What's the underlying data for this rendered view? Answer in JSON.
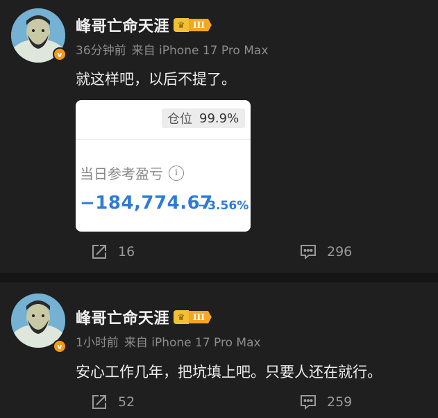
{
  "posts": [
    {
      "author": "峰哥亡命天涯",
      "rank_level": "III",
      "time": "36分钟前",
      "source": "来自 iPhone 17 Pro Max",
      "text": "就这样吧，以后不提了。",
      "card": {
        "position_label": "仓位",
        "position_value": "99.9%",
        "pnl_label": "当日参考盈亏",
        "info_glyph": "i",
        "pnl_value": "−184,774.67",
        "pnl_percent": "−3.56%"
      },
      "share_count": "16",
      "comment_count": "296"
    },
    {
      "author": "峰哥亡命天涯",
      "rank_level": "III",
      "time": "1小时前",
      "source": "来自 iPhone 17 Pro Max",
      "text": "安心工作几年，把坑填上吧。只要人还在就行。",
      "share_count": "52",
      "comment_count": "259"
    }
  ],
  "verified_mark": "v",
  "colors": {
    "background": "#1f1f1f",
    "verified_badge": "#f39a18",
    "rank_badge": "#f5a623",
    "loss_blue": "#2e7bd6"
  },
  "icons": [
    "avatar",
    "verified-icon",
    "crown-icon",
    "info-icon",
    "share-icon",
    "comment-icon"
  ]
}
